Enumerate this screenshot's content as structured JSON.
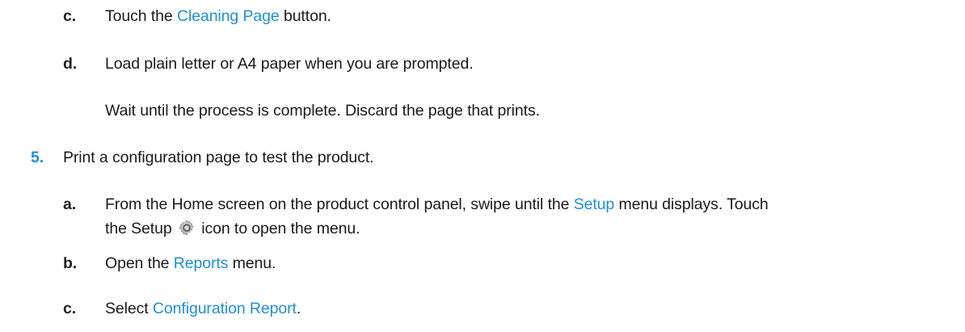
{
  "steps": [
    {
      "marker": "c.",
      "parts": [
        "Touch the ",
        "Cleaning Page",
        " button."
      ]
    },
    {
      "marker": "d.",
      "text": "Load plain letter or A4 paper when you are prompted.",
      "note": "Wait until the process is complete. Discard the page that prints."
    },
    {
      "marker": "5.",
      "text": "Print a configuration page to test the product."
    },
    {
      "marker": "a.",
      "line1": [
        "From the Home screen on the product control panel, swipe until the ",
        "Setup",
        " menu displays. Touch"
      ],
      "line2": [
        "the Setup ",
        " icon to open the menu."
      ],
      "icon": "gear-icon"
    },
    {
      "marker": "b.",
      "parts": [
        "Open the ",
        "Reports",
        " menu."
      ]
    },
    {
      "marker": "c.",
      "parts": [
        "Select ",
        "Configuration Report",
        "."
      ]
    }
  ],
  "colors": {
    "link": "#1f8fd6",
    "text": "#1a1a1a"
  }
}
